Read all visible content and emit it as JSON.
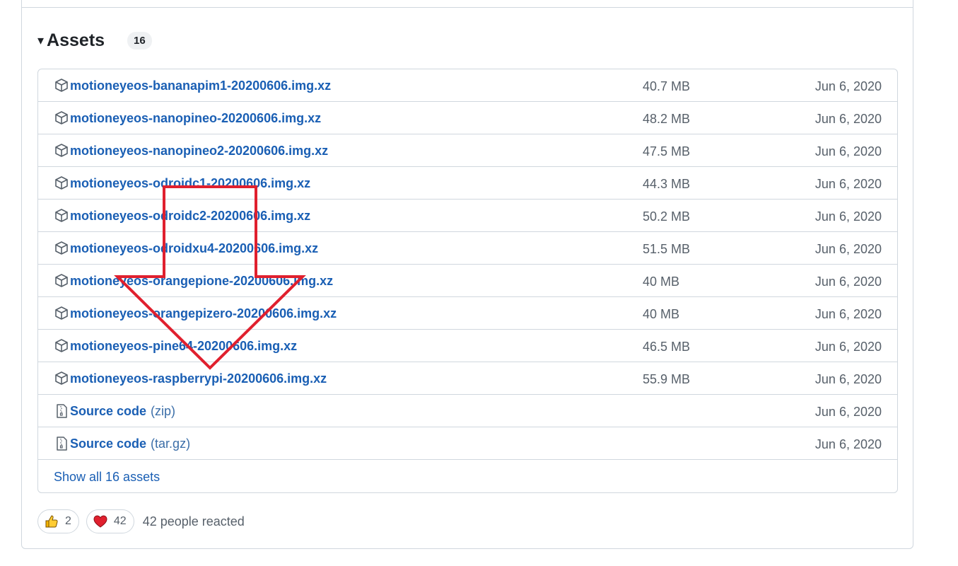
{
  "assets": {
    "title": "Assets",
    "count": "16",
    "caret": "▾",
    "items": [
      {
        "name": "motioneyeos-bananapim1-20200606.img.xz",
        "size": "40.7 MB",
        "date": "Jun 6, 2020",
        "icon": "package-icon"
      },
      {
        "name": "motioneyeos-nanopineo-20200606.img.xz",
        "size": "48.2 MB",
        "date": "Jun 6, 2020",
        "icon": "package-icon"
      },
      {
        "name": "motioneyeos-nanopineo2-20200606.img.xz",
        "size": "47.5 MB",
        "date": "Jun 6, 2020",
        "icon": "package-icon"
      },
      {
        "name": "motioneyeos-odroidc1-20200606.img.xz",
        "size": "44.3 MB",
        "date": "Jun 6, 2020",
        "icon": "package-icon"
      },
      {
        "name": "motioneyeos-odroidc2-20200606.img.xz",
        "size": "50.2 MB",
        "date": "Jun 6, 2020",
        "icon": "package-icon"
      },
      {
        "name": "motioneyeos-odroidxu4-20200606.img.xz",
        "size": "51.5 MB",
        "date": "Jun 6, 2020",
        "icon": "package-icon"
      },
      {
        "name": "motioneyeos-orangepione-20200606.img.xz",
        "size": "40 MB",
        "date": "Jun 6, 2020",
        "icon": "package-icon"
      },
      {
        "name": "motioneyeos-orangepizero-20200606.img.xz",
        "size": "40 MB",
        "date": "Jun 6, 2020",
        "icon": "package-icon"
      },
      {
        "name": "motioneyeos-pine64-20200606.img.xz",
        "size": "46.5 MB",
        "date": "Jun 6, 2020",
        "icon": "package-icon"
      },
      {
        "name": "motioneyeos-raspberrypi-20200606.img.xz",
        "size": "55.9 MB",
        "date": "Jun 6, 2020",
        "icon": "package-icon"
      }
    ],
    "source": [
      {
        "name": "Source code",
        "suffix": "(zip)",
        "date": "Jun 6, 2020",
        "icon": "file-zip-icon"
      },
      {
        "name": "Source code",
        "suffix": "(tar.gz)",
        "date": "Jun 6, 2020",
        "icon": "file-zip-icon"
      }
    ],
    "show_all": "Show all 16 assets"
  },
  "reactions": {
    "thumbs_up_count": "2",
    "heart_count": "42",
    "summary": "42 people reacted"
  },
  "colors": {
    "link": "#1a5fb4",
    "muted": "#57606a",
    "border": "#d0d7de",
    "annotation_arrow": "#e0202e"
  }
}
